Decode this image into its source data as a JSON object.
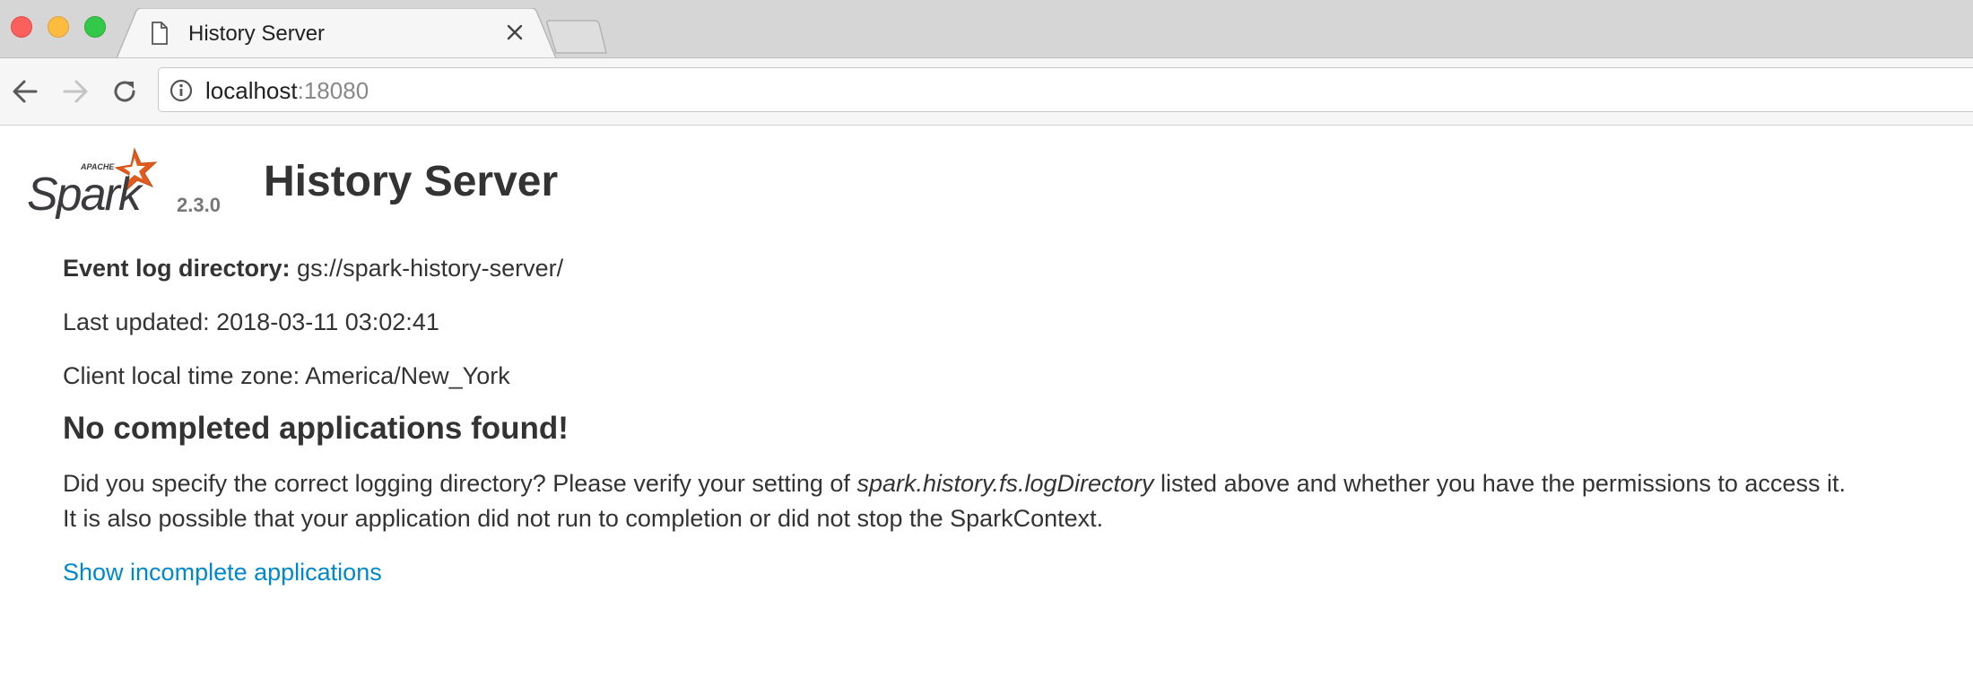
{
  "browser": {
    "tab": {
      "title": "History Server",
      "icon": "file-icon"
    },
    "url": {
      "host": "localhost",
      "port": ":18080"
    }
  },
  "page": {
    "logo": {
      "brand": "APACHE",
      "name": "Spark"
    },
    "version": "2.3.0",
    "title": "History Server",
    "event_log": {
      "label": "Event log directory:",
      "value": " gs://spark-history-server/"
    },
    "last_updated": "Last updated: 2018-03-11 03:02:41",
    "time_zone": "Client local time zone: America/New_York",
    "no_apps_heading": "No completed applications found!",
    "desc_line1": {
      "before": "Did you specify the correct logging directory? Please verify your setting of ",
      "setting": "spark.history.fs.logDirectory",
      "after": " listed above and whether you have the permissions to access it."
    },
    "desc_line2": "It is also possible that your application did not run to completion or did not stop the SparkContext.",
    "show_incomplete_link": "Show incomplete applications"
  },
  "colors": {
    "link": "#0088cc",
    "text": "#333333",
    "spark_orange": "#e25a1c",
    "spark_gray": "#3c3a3e"
  }
}
